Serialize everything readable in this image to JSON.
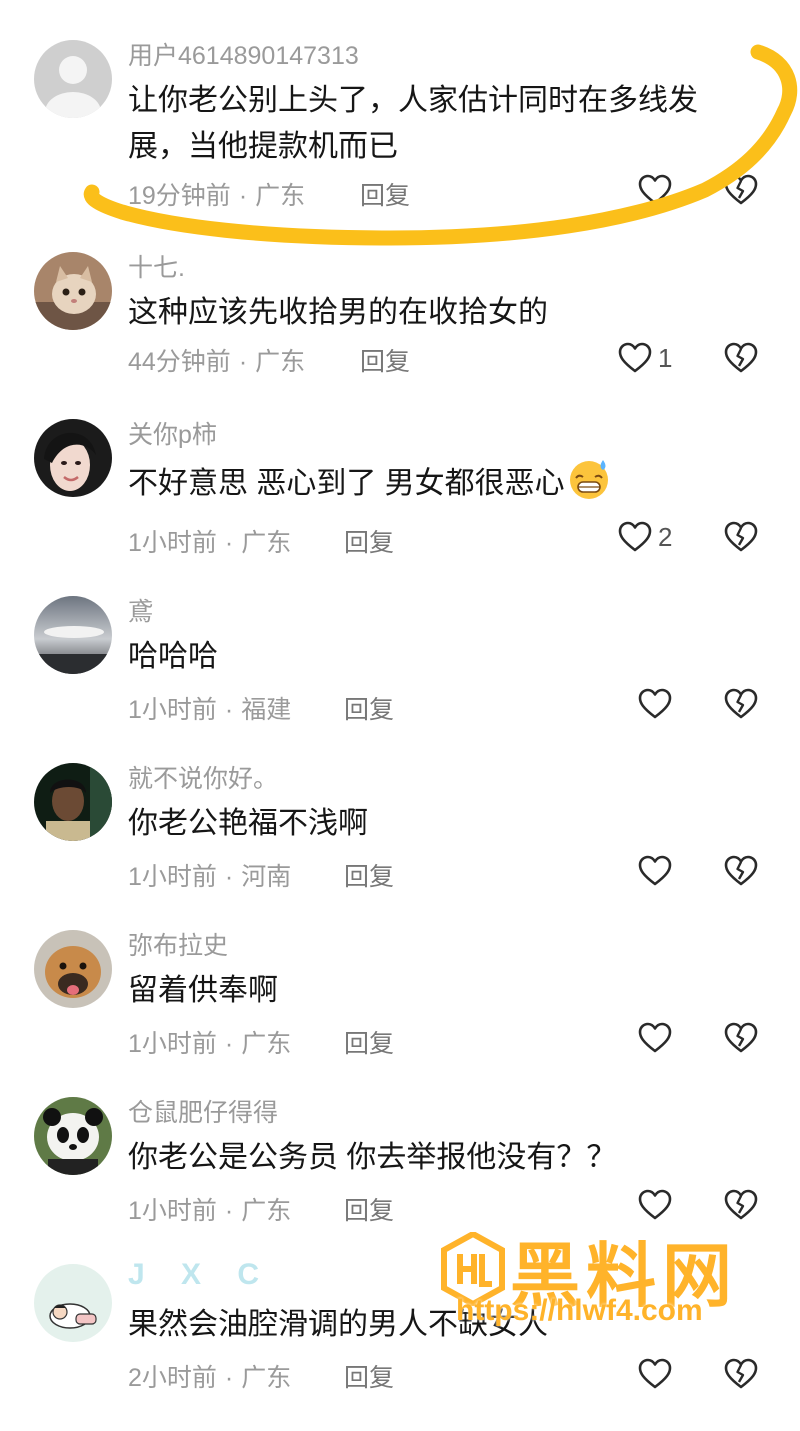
{
  "comments": [
    {
      "user": "用户4614890147313",
      "text": "让你老公别上头了，人家估计同时在多线发展，当他提款机而已",
      "time": "19分钟前",
      "region": "广东",
      "reply": "回复",
      "likes": "",
      "avatar": "default-avatar"
    },
    {
      "user": "十七.",
      "text": "这种应该先收拾男的在收拾女的",
      "time": "44分钟前",
      "region": "广东",
      "reply": "回复",
      "likes": "1",
      "avatar": "cat-photo"
    },
    {
      "user": "关你p柿",
      "text": "不好意思 恶心到了 男女都很恶心",
      "time": "1小时前",
      "region": "广东",
      "reply": "回复",
      "likes": "2",
      "avatar": "girl-photo",
      "emoji": "grinning-sweat-emoji"
    },
    {
      "user": "鳶",
      "text": "哈哈哈",
      "time": "1小时前",
      "region": "福建",
      "reply": "回复",
      "likes": "",
      "avatar": "sky-photo"
    },
    {
      "user": "就不说你好。",
      "text": "你老公艳福不浅啊",
      "time": "1小时前",
      "region": "河南",
      "reply": "回复",
      "likes": "",
      "avatar": "man-photo"
    },
    {
      "user": "弥布拉史",
      "text": "留着供奉啊",
      "time": "1小时前",
      "region": "广东",
      "reply": "回复",
      "likes": "",
      "avatar": "dog-photo"
    },
    {
      "user": "仓鼠肥仔得得",
      "text": "你老公是公务员 你去举报他没有？？",
      "time": "1小时前",
      "region": "广东",
      "reply": "回复",
      "likes": "",
      "avatar": "panda-photo"
    },
    {
      "user": "J X C",
      "text": "果然会油腔滑调的男人不缺女人",
      "time": "2小时前",
      "region": "广东",
      "reply": "回复",
      "likes": "",
      "avatar": "cartoon-photo"
    }
  ],
  "meta_separator": "·",
  "watermark": {
    "title": "黑料网",
    "url": "https://hlwf4.com"
  },
  "colors": {
    "annotation": "#fbbf1a",
    "watermark": "#ffb32a",
    "meta": "#9a9a9a",
    "text": "#161616"
  }
}
